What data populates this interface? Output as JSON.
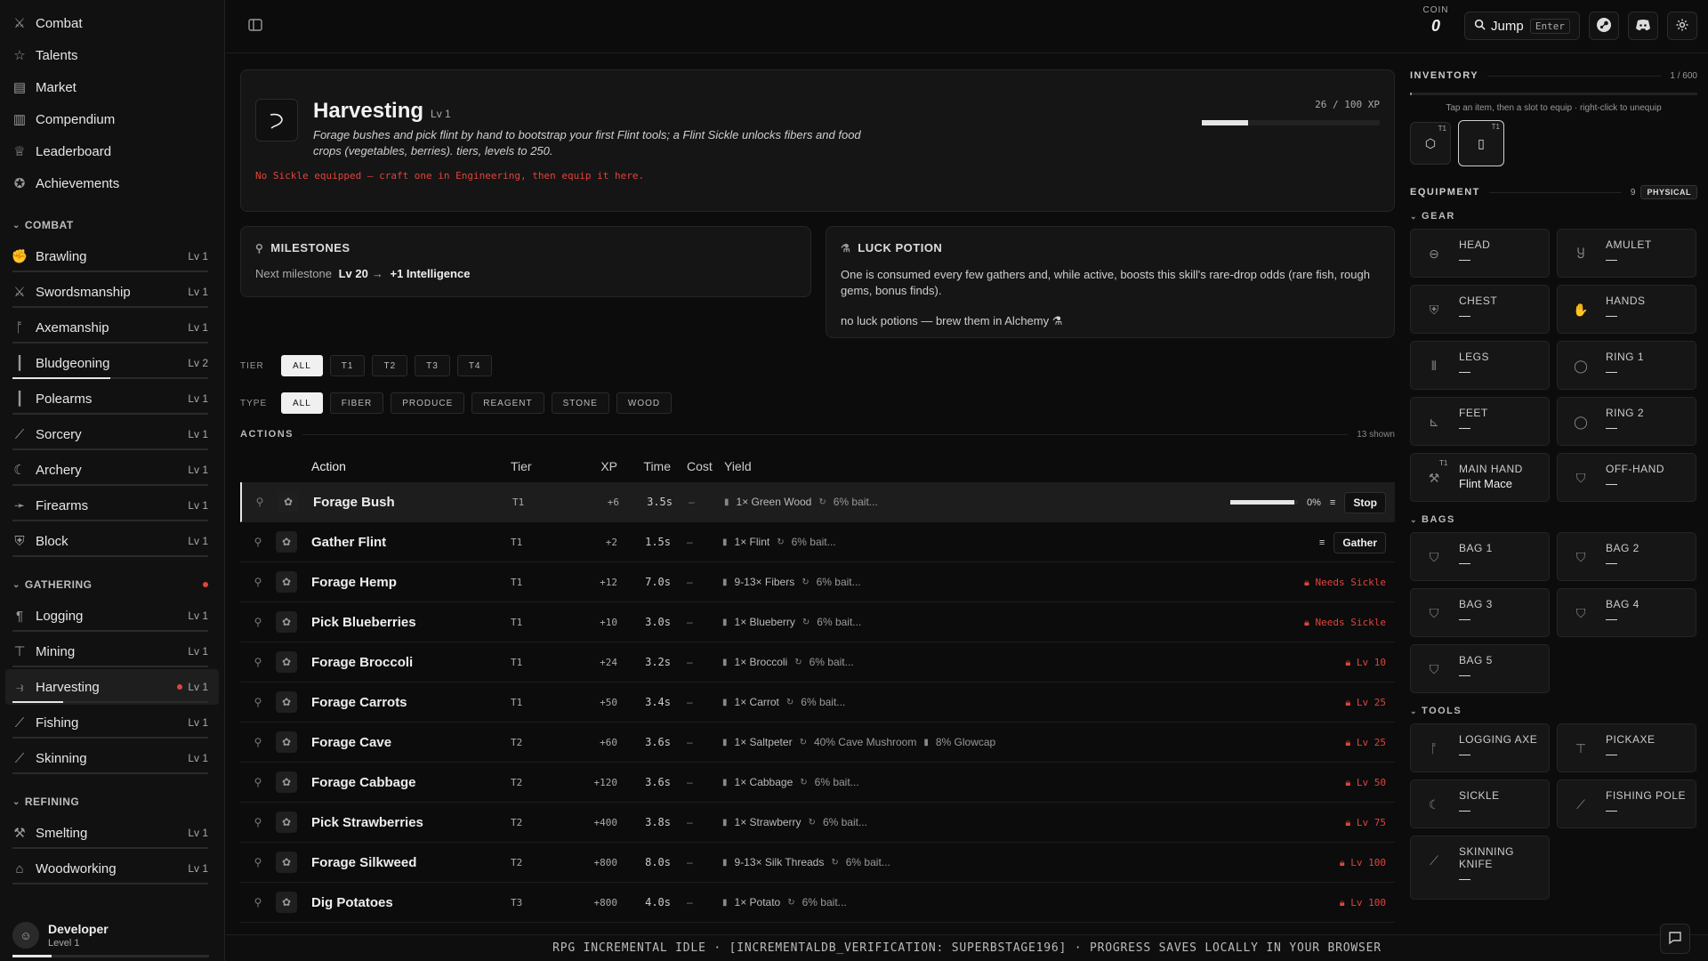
{
  "nav": {
    "top": [
      {
        "label": "Combat",
        "icon": "sword-icon"
      },
      {
        "label": "Talents",
        "icon": "star-icon"
      },
      {
        "label": "Market",
        "icon": "market-icon"
      },
      {
        "label": "Compendium",
        "icon": "book-icon"
      },
      {
        "label": "Leaderboard",
        "icon": "trophy-icon"
      },
      {
        "label": "Achievements",
        "icon": "medal-icon"
      }
    ],
    "sections": [
      {
        "title": "COMBAT",
        "dot": false,
        "skills": [
          {
            "label": "Brawling",
            "level": "Lv 1",
            "progress": 0
          },
          {
            "label": "Swordsmanship",
            "level": "Lv 1",
            "progress": 0
          },
          {
            "label": "Axemanship",
            "level": "Lv 1",
            "progress": 0
          },
          {
            "label": "Bludgeoning",
            "level": "Lv 2",
            "progress": 0.5
          },
          {
            "label": "Polearms",
            "level": "Lv 1",
            "progress": 0
          },
          {
            "label": "Sorcery",
            "level": "Lv 1",
            "progress": 0
          },
          {
            "label": "Archery",
            "level": "Lv 1",
            "progress": 0
          },
          {
            "label": "Firearms",
            "level": "Lv 1",
            "progress": 0
          },
          {
            "label": "Block",
            "level": "Lv 1",
            "progress": 0
          }
        ]
      },
      {
        "title": "GATHERING",
        "dot": true,
        "skills": [
          {
            "label": "Logging",
            "level": "Lv 1",
            "progress": 0
          },
          {
            "label": "Mining",
            "level": "Lv 1",
            "progress": 0
          },
          {
            "label": "Harvesting",
            "level": "Lv 1",
            "progress": 0.26,
            "active": true,
            "dot": true
          },
          {
            "label": "Fishing",
            "level": "Lv 1",
            "progress": 0
          },
          {
            "label": "Skinning",
            "level": "Lv 1",
            "progress": 0
          }
        ]
      },
      {
        "title": "REFINING",
        "dot": false,
        "skills": [
          {
            "label": "Smelting",
            "level": "Lv 1",
            "progress": 0
          },
          {
            "label": "Woodworking",
            "level": "Lv 1",
            "progress": 0
          }
        ]
      }
    ],
    "user": {
      "name": "Developer",
      "level": "Level 1",
      "progress": 0.2
    }
  },
  "topbar": {
    "coin_label": "COIN",
    "coin_value": "0",
    "jump_label": "Jump",
    "jump_key": "Enter"
  },
  "hero": {
    "title": "Harvesting",
    "level": "Lv 1",
    "description": "Forage bushes and pick flint by hand to bootstrap your first Flint tools; a Flint Sickle unlocks fibers and food crops (vegetables, berries). tiers, levels to 250.",
    "warning": "No Sickle equipped — craft one in Engineering, then equip it here.",
    "xp_text": "26 / 100 XP",
    "xp_progress": 0.26
  },
  "milestones": {
    "title": "MILESTONES",
    "prefix": "Next milestone",
    "level": "Lv 20",
    "arrow": "→",
    "reward": "+1 Intelligence"
  },
  "luck": {
    "title": "LUCK POTION",
    "text": "One is consumed every few gathers and, while active, boosts this skill's rare-drop odds (rare fish, rough gems, bonus finds).",
    "status": "no luck potions — brew them in Alchemy ⚗"
  },
  "filters": {
    "tier_label": "TIER",
    "tiers": [
      "ALL",
      "T1",
      "T2",
      "T3",
      "T4"
    ],
    "type_label": "TYPE",
    "types": [
      "ALL",
      "FIBER",
      "PRODUCE",
      "REAGENT",
      "STONE",
      "WOOD"
    ]
  },
  "actions": {
    "title": "ACTIONS",
    "shown": "13 shown",
    "columns": {
      "action": "Action",
      "tier": "Tier",
      "xp": "XP",
      "time": "Time",
      "cost": "Cost",
      "yield": "Yield"
    },
    "rows": [
      {
        "name": "Forage Bush",
        "tier": "T1",
        "xp": "+6",
        "time": "3.5s",
        "cost": "–",
        "yield": "1× Green Wood",
        "extra": "6% bait...",
        "extra2": "",
        "state": "running",
        "progress_text": "0%",
        "progress": 0.95,
        "button": "Stop",
        "active": true
      },
      {
        "name": "Gather Flint",
        "tier": "T1",
        "xp": "+2",
        "time": "1.5s",
        "cost": "–",
        "yield": "1× Flint",
        "extra": "6% bait...",
        "extra2": "",
        "state": "button",
        "button": "Gather"
      },
      {
        "name": "Forage Hemp",
        "tier": "T1",
        "xp": "+12",
        "time": "7.0s",
        "cost": "–",
        "yield": "9-13× Fibers",
        "extra": "6% bait...",
        "extra2": "",
        "state": "lock",
        "lock": "Needs Sickle"
      },
      {
        "name": "Pick Blueberries",
        "tier": "T1",
        "xp": "+10",
        "time": "3.0s",
        "cost": "–",
        "yield": "1× Blueberry",
        "extra": "6% bait...",
        "extra2": "",
        "state": "lock",
        "lock": "Needs Sickle"
      },
      {
        "name": "Forage Broccoli",
        "tier": "T1",
        "xp": "+24",
        "time": "3.2s",
        "cost": "–",
        "yield": "1× Broccoli",
        "extra": "6% bait...",
        "extra2": "",
        "state": "lock",
        "lock": "Lv 10"
      },
      {
        "name": "Forage Carrots",
        "tier": "T1",
        "xp": "+50",
        "time": "3.4s",
        "cost": "–",
        "yield": "1× Carrot",
        "extra": "6% bait...",
        "extra2": "",
        "state": "lock",
        "lock": "Lv 25"
      },
      {
        "name": "Forage Cave",
        "tier": "T2",
        "xp": "+60",
        "time": "3.6s",
        "cost": "–",
        "yield": "1× Saltpeter",
        "extra": "40% Cave Mushroom",
        "extra2": "8% Glowcap",
        "state": "lock",
        "lock": "Lv 25"
      },
      {
        "name": "Forage Cabbage",
        "tier": "T2",
        "xp": "+120",
        "time": "3.6s",
        "cost": "–",
        "yield": "1× Cabbage",
        "extra": "6% bait...",
        "extra2": "",
        "state": "lock",
        "lock": "Lv 50"
      },
      {
        "name": "Pick Strawberries",
        "tier": "T2",
        "xp": "+400",
        "time": "3.8s",
        "cost": "–",
        "yield": "1× Strawberry",
        "extra": "6% bait...",
        "extra2": "",
        "state": "lock",
        "lock": "Lv 75"
      },
      {
        "name": "Forage Silkweed",
        "tier": "T2",
        "xp": "+800",
        "time": "8.0s",
        "cost": "–",
        "yield": "9-13× Silk Threads",
        "extra": "6% bait...",
        "extra2": "",
        "state": "lock",
        "lock": "Lv 100"
      },
      {
        "name": "Dig Potatoes",
        "tier": "T3",
        "xp": "+800",
        "time": "4.0s",
        "cost": "–",
        "yield": "1× Potato",
        "extra": "6% bait...",
        "extra2": "",
        "state": "lock",
        "lock": "Lv 100"
      }
    ]
  },
  "inventory": {
    "title": "INVENTORY",
    "count": "1 / 600",
    "fill": 0.00167,
    "hint": "Tap an item, then a slot to equip · right-click to unequip",
    "slots": [
      {
        "tier": "T1",
        "icon": "crate-icon"
      },
      {
        "tier": "T1",
        "icon": "jar-icon",
        "selected": true
      }
    ]
  },
  "equipment": {
    "title": "EQUIPMENT",
    "count": "9",
    "badge": "PHYSICAL",
    "gear_label": "GEAR",
    "gear": [
      {
        "name": "HEAD",
        "value": "—"
      },
      {
        "name": "AMULET",
        "value": "—"
      },
      {
        "name": "CHEST",
        "value": "—"
      },
      {
        "name": "HANDS",
        "value": "—"
      },
      {
        "name": "LEGS",
        "value": "—"
      },
      {
        "name": "RING 1",
        "value": "—"
      },
      {
        "name": "FEET",
        "value": "—"
      },
      {
        "name": "RING 2",
        "value": "—"
      },
      {
        "name": "MAIN HAND",
        "value": "Flint Mace",
        "tier": "T1"
      },
      {
        "name": "OFF-HAND",
        "value": "—"
      }
    ],
    "bags_label": "BAGS",
    "bags": [
      {
        "name": "BAG 1",
        "value": "—"
      },
      {
        "name": "BAG 2",
        "value": "—"
      },
      {
        "name": "BAG 3",
        "value": "—"
      },
      {
        "name": "BAG 4",
        "value": "—"
      },
      {
        "name": "BAG 5",
        "value": "—"
      }
    ],
    "tools_label": "TOOLS",
    "tools": [
      {
        "name": "LOGGING AXE",
        "value": "—"
      },
      {
        "name": "PICKAXE",
        "value": "—"
      },
      {
        "name": "SICKLE",
        "value": "—"
      },
      {
        "name": "FISHING POLE",
        "value": "—"
      },
      {
        "name": "SKINNING KNIFE",
        "value": "—"
      }
    ]
  },
  "footer": "RPG INCREMENTAL IDLE · [INCREMENTALDB_VERIFICATION: SUPERBSTAGE196] · PROGRESS SAVES LOCALLY IN YOUR BROWSER"
}
